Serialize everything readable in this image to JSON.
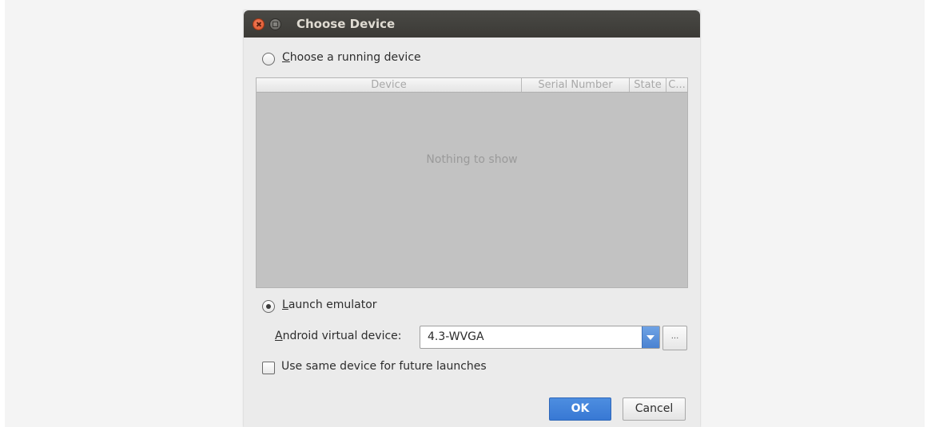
{
  "window": {
    "title": "Choose Device"
  },
  "running_device": {
    "label_mnemonic": "C",
    "label_rest": "hoose a running device",
    "selected": false
  },
  "device_table": {
    "columns": [
      "Device",
      "Serial Number",
      "State",
      "C..."
    ],
    "empty_message": "Nothing to show"
  },
  "launch_emulator": {
    "label_mnemonic": "L",
    "label_rest": "aunch emulator",
    "selected": true
  },
  "avd": {
    "label_mnemonic": "A",
    "label_rest": "ndroid virtual device:",
    "selected_value": "4.3-WVGA",
    "more_label": "..."
  },
  "future_launches": {
    "label": "Use same device for future launches",
    "checked": false
  },
  "buttons": {
    "ok": "OK",
    "cancel": "Cancel"
  },
  "colors": {
    "accent": "#3d7fd7",
    "titlebar": "#3c3b37",
    "close_button": "#e9643b"
  }
}
